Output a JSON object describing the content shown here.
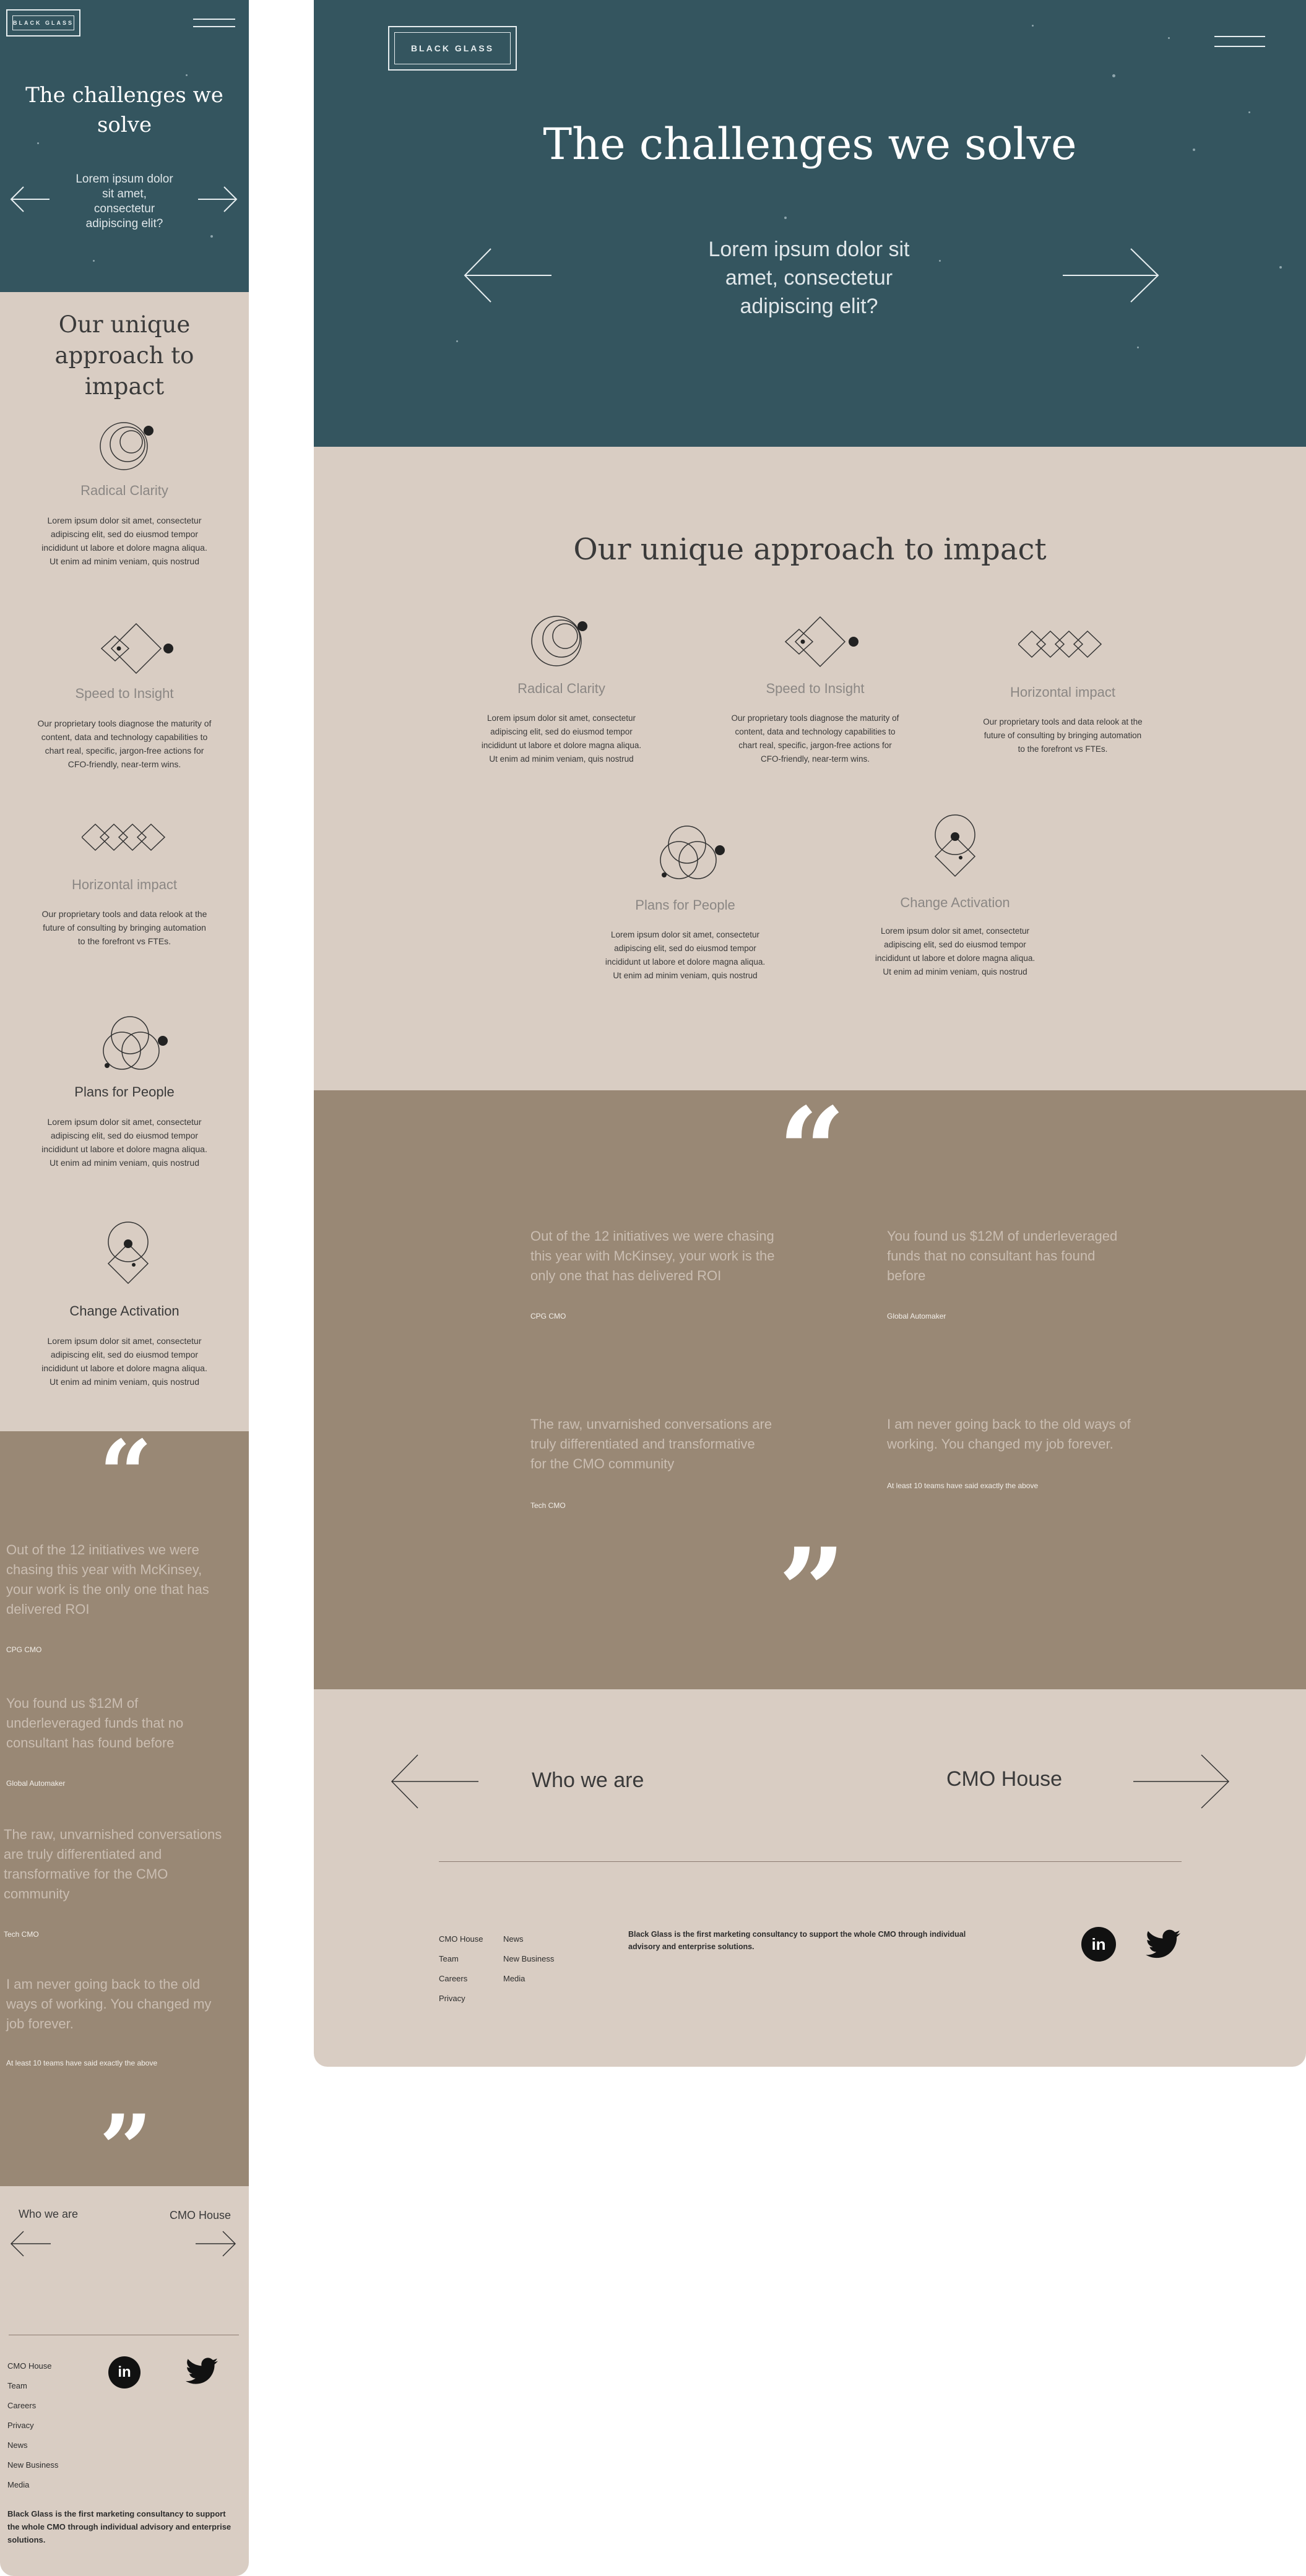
{
  "brand": {
    "logo_text": "BLACK GLASS"
  },
  "hero": {
    "title": "The challenges we solve",
    "subtitle_mobile": [
      "Lorem ipsum dolor",
      "sit amet,",
      "consectetur",
      "adipiscing elit?"
    ],
    "subtitle_desktop": [
      "Lorem ipsum dolor sit",
      "amet, consectetur",
      "adipiscing elit?"
    ]
  },
  "approach": {
    "heading": "Our unique approach to impact",
    "heading_mobile": [
      "Our unique",
      "approach to impact"
    ],
    "features": [
      {
        "title": "Radical Clarity",
        "icon": "circles-icon",
        "body": [
          "Lorem ipsum dolor sit amet, consectetur",
          "adipiscing elit, sed do eiusmod tempor",
          "incididunt ut labore et dolore magna aliqua.",
          "Ut enim ad minim veniam, quis nostrud"
        ]
      },
      {
        "title": "Speed to Insight",
        "icon": "diamonds-icon",
        "body": [
          "Our proprietary tools diagnose the maturity of",
          "content, data and technology capabilities to",
          "chart real, specific, jargon-free actions for",
          "CFO-friendly, near-term wins."
        ]
      },
      {
        "title": "Horizontal impact",
        "icon": "diamond-row-icon",
        "body": [
          "Our proprietary tools and data relook at the",
          "future of consulting by bringing automation",
          "to the forefront vs FTEs."
        ]
      },
      {
        "title": "Plans for People",
        "icon": "venn-icon",
        "body": [
          "Lorem ipsum dolor sit amet, consectetur",
          "adipiscing elit, sed do eiusmod tempor",
          "incididunt ut labore et dolore magna aliqua.",
          "Ut enim ad minim veniam, quis nostrud"
        ]
      },
      {
        "title": "Change Activation",
        "icon": "circle-diamond-icon",
        "body": [
          "Lorem ipsum dolor sit amet, consectetur",
          "adipiscing elit, sed do eiusmod tempor",
          "incididunt ut labore et dolore magna aliqua.",
          "Ut enim ad minim veniam, quis nostrud"
        ]
      }
    ]
  },
  "testimonials": {
    "open_quote": "“",
    "close_quote": "”",
    "items": [
      {
        "text_desktop": [
          "Out of the 12 initiatives we were chasing",
          "this year with McKinsey, your work is the",
          "only one that has delivered ROI"
        ],
        "text_mobile": [
          "Out of the 12 initiatives we were",
          "chasing this year with McKinsey,",
          "your work is the only one that has",
          "delivered ROI"
        ],
        "source": "CPG CMO"
      },
      {
        "text_desktop": [
          "You found us $12M of underleveraged",
          "funds that no consultant has found",
          "before"
        ],
        "text_mobile": [
          "You found us $12M of",
          "underleveraged funds that no",
          "consultant has found before"
        ],
        "source": "Global Automaker"
      },
      {
        "text_desktop": [
          "The raw, unvarnished conversations are",
          "truly differentiated and transformative",
          "for the CMO community"
        ],
        "text_mobile": [
          "The raw, unvarnished conversations",
          "are truly differentiated and",
          "transformative for the CMO",
          "community"
        ],
        "source": "Tech CMO"
      },
      {
        "text_desktop": [
          "I am never going back to the old ways of",
          "working. You changed my job forever."
        ],
        "text_mobile": [
          "I am never going back to the old",
          "ways of working. You changed my",
          "job forever."
        ],
        "source": "At least 10 teams have said exactly the above"
      }
    ]
  },
  "pagination": {
    "prev": "Who we are",
    "next": "CMO House"
  },
  "footer": {
    "links_col1": [
      "CMO House",
      "Team",
      "Careers",
      "Privacy"
    ],
    "links_col2": [
      "News",
      "New Business",
      "Media"
    ],
    "links_mobile": [
      "CMO House",
      "Team",
      "Careers",
      "Privacy",
      "News",
      "New Business",
      "Media"
    ],
    "about_desktop": [
      "Black Glass is the first marketing consultancy to support the whole CMO through individual",
      "advisory and enterprise solutions."
    ],
    "about_mobile": [
      "Black Glass is the first marketing consultancy to support",
      "the whole CMO through individual advisory and enterprise",
      "solutions."
    ],
    "social": [
      {
        "name": "linkedin-icon",
        "label": "in"
      },
      {
        "name": "twitter-icon",
        "label": ""
      }
    ]
  },
  "colors": {
    "hero_bg": "#34555f",
    "sand_bg": "#d9cdc3",
    "quote_bg": "#998875"
  }
}
